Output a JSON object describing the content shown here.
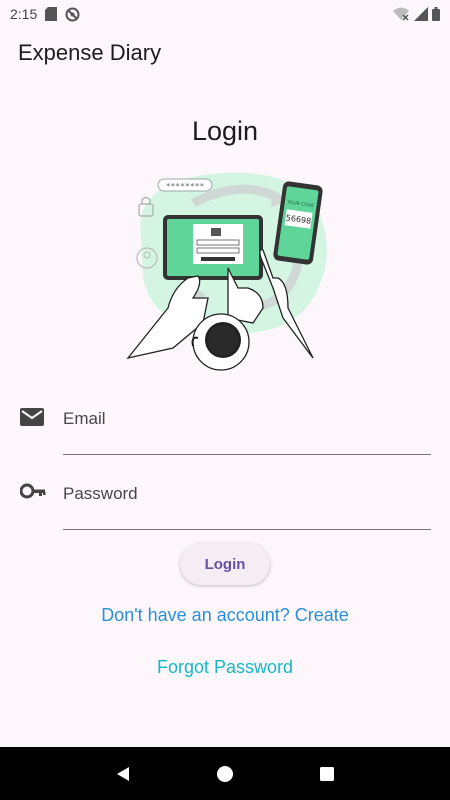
{
  "status_bar": {
    "time": "2:15",
    "icons": [
      "sd-card-icon",
      "no-sync-icon",
      "wifi-off-icon",
      "signal-icon",
      "battery-icon"
    ]
  },
  "app_bar": {
    "title": "Expense Diary"
  },
  "page": {
    "title": "Login"
  },
  "illustration": {
    "code_label": "YOUR CODE",
    "code_value": "56698",
    "password_mask": "********"
  },
  "form": {
    "email_label": "Email",
    "password_label": "Password"
  },
  "actions": {
    "login_label": "Login",
    "create_link": "Don't have an account? Create",
    "forgot_link": "Forgot Password"
  },
  "colors": {
    "accent": "#6750a4",
    "link_blue": "#2a8fd6",
    "link_teal": "#17b7c7",
    "illustration_green": "#5fd59a"
  }
}
